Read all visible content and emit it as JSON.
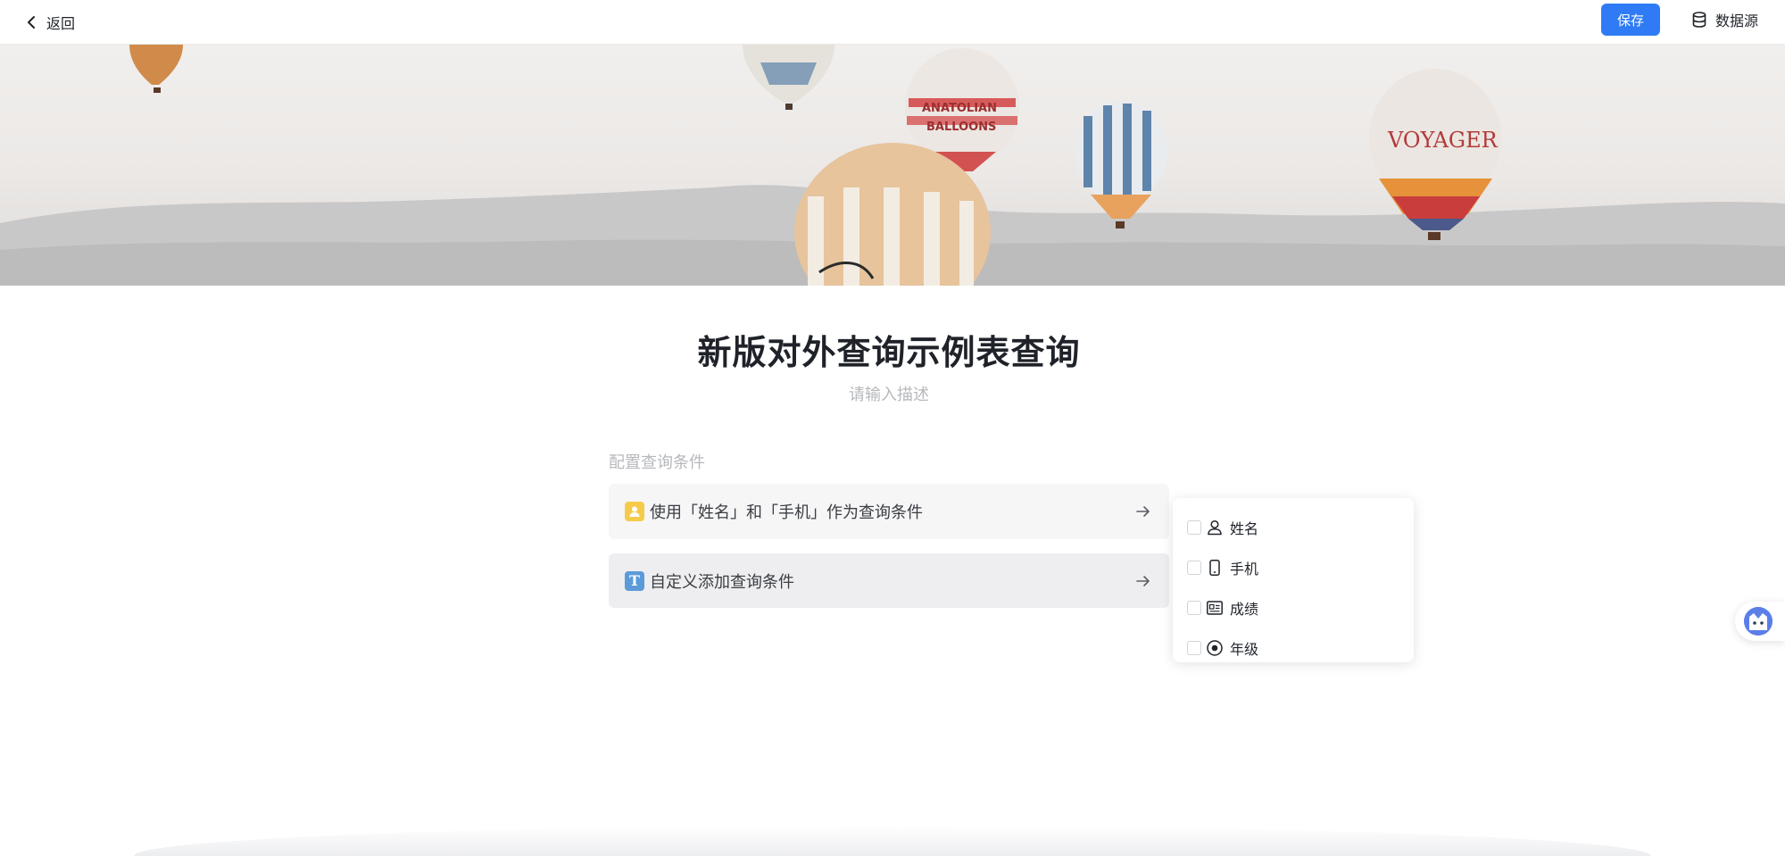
{
  "header": {
    "back_label": "返回",
    "save_label": "保存",
    "datasource_label": "数据源",
    "accent_color": "#2f7bf6"
  },
  "banner": {
    "image_subject": "hot air balloons over hills",
    "balloon_texts": [
      "ANATOLIAN BALLOONS",
      "VOYAGER"
    ]
  },
  "page": {
    "title": "新版对外查询示例表查询",
    "description_placeholder": "请输入描述"
  },
  "conditions": {
    "section_label": "配置查询条件",
    "options": [
      {
        "label": "使用「姓名」和「手机」作为查询条件",
        "icon": "user-icon"
      },
      {
        "label": "自定义添加查询条件",
        "icon": "text-field-icon"
      }
    ]
  },
  "field_panel": {
    "fields": [
      {
        "label": "姓名",
        "icon": "person-icon",
        "checked": false
      },
      {
        "label": "手机",
        "icon": "phone-icon",
        "checked": false
      },
      {
        "label": "成绩",
        "icon": "id-card-icon",
        "checked": false
      },
      {
        "label": "年级",
        "icon": "radio-icon",
        "checked": false
      }
    ]
  },
  "assistant": {
    "icon": "assistant-avatar-icon"
  }
}
